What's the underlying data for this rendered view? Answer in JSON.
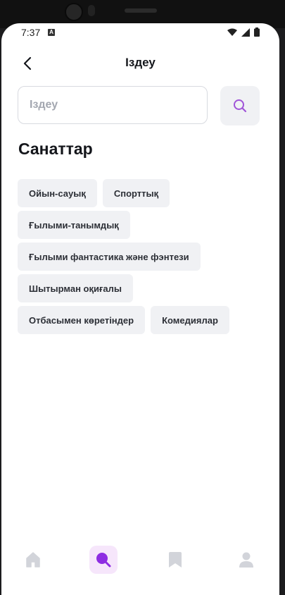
{
  "status_bar": {
    "time": "7:37",
    "notification_badge": "A"
  },
  "header": {
    "title": "Іздеу",
    "back_icon": "chevron-left-icon"
  },
  "search": {
    "placeholder": "Іздеу",
    "value": "",
    "button_icon": "search-icon"
  },
  "section": {
    "title": "Санаттар"
  },
  "categories": [
    "Ойын-сауық",
    "Спорттық",
    "Ғылыми-танымдық",
    "Ғылыми фантастика және фэнтези",
    "Шытырман оқиғалы",
    "Отбасымен көретіндер",
    "Комедиялар"
  ],
  "tabbar": {
    "items": [
      {
        "icon": "home-icon",
        "active": false
      },
      {
        "icon": "search-icon",
        "active": true
      },
      {
        "icon": "bookmark-icon",
        "active": false
      },
      {
        "icon": "profile-icon",
        "active": false
      }
    ]
  },
  "colors": {
    "accent": "#8e2de2",
    "accent_bg": "#f6e6fb",
    "chip_bg": "#f0f1f4",
    "inactive_icon": "#d2d4da"
  }
}
